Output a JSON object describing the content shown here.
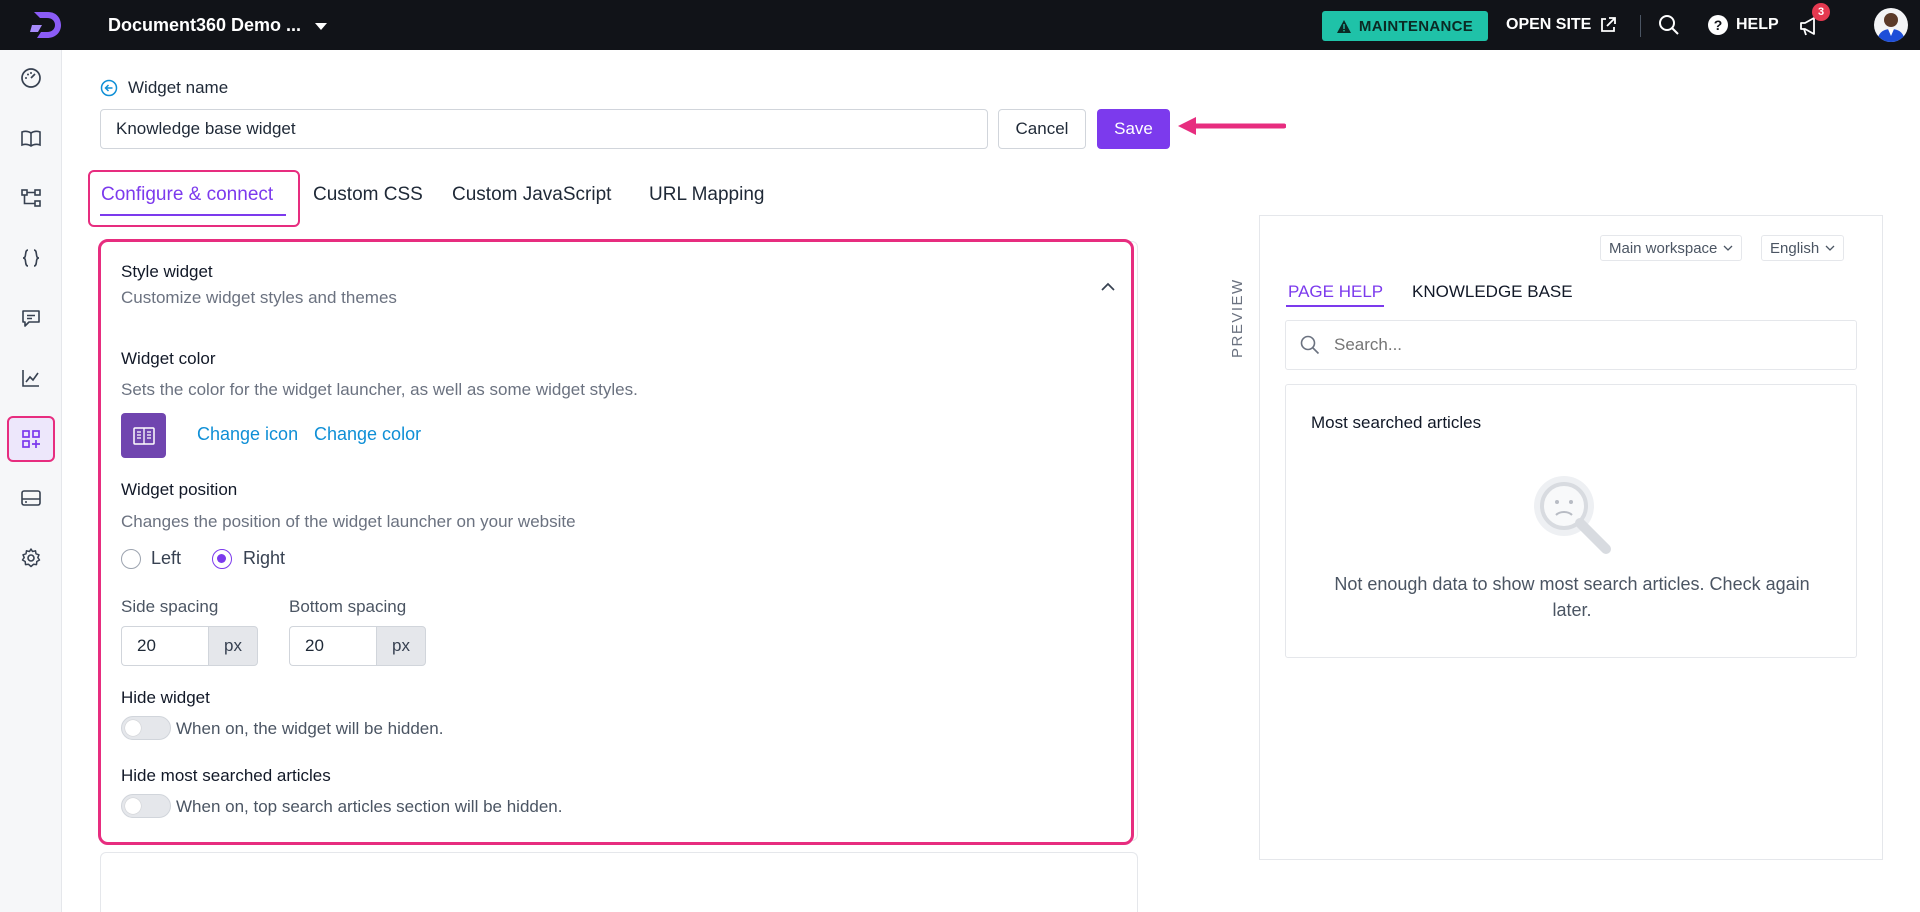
{
  "topbar": {
    "project_name": "Document360 Demo ...",
    "maintenance_label": "MAINTENANCE",
    "open_site_label": "OPEN SITE",
    "help_label": "HELP",
    "notification_count": "3"
  },
  "sidebar": {
    "items": [
      {
        "icon": "dashboard-icon"
      },
      {
        "icon": "documentation-icon"
      },
      {
        "icon": "category-tree-icon"
      },
      {
        "icon": "api-docs-icon"
      },
      {
        "icon": "feedback-icon"
      },
      {
        "icon": "analytics-icon"
      },
      {
        "icon": "widgets-icon",
        "active": true
      },
      {
        "icon": "drive-icon"
      },
      {
        "icon": "settings-icon"
      }
    ]
  },
  "header": {
    "back_label": "Widget name",
    "widget_name_value": "Knowledge base widget",
    "cancel_label": "Cancel",
    "save_label": "Save"
  },
  "tabs": [
    {
      "label": "Configure & connect",
      "active": true
    },
    {
      "label": "Custom CSS"
    },
    {
      "label": "Custom JavaScript"
    },
    {
      "label": "URL Mapping"
    }
  ],
  "style_widget": {
    "title": "Style widget",
    "subtitle": "Customize widget styles and themes",
    "widget_color": {
      "title": "Widget color",
      "description": "Sets the color for the widget launcher, as well as some widget styles.",
      "swatch_color": "#7045af",
      "change_icon_label": "Change icon",
      "change_color_label": "Change color"
    },
    "widget_position": {
      "title": "Widget position",
      "description": "Changes the position of the widget launcher on your website",
      "options": [
        "Left",
        "Right"
      ],
      "selected": "Right"
    },
    "side_spacing": {
      "label": "Side spacing",
      "value": "20",
      "unit": "px"
    },
    "bottom_spacing": {
      "label": "Bottom spacing",
      "value": "20",
      "unit": "px"
    },
    "hide_widget": {
      "title": "Hide widget",
      "description": "When on, the widget will be hidden.",
      "on": false
    },
    "hide_most_searched": {
      "title": "Hide most searched articles",
      "description": "When on, top search articles section will be hidden.",
      "on": false
    }
  },
  "preview": {
    "vertical_label": "PREVIEW",
    "workspace_dropdown": "Main workspace",
    "language_dropdown": "English",
    "tabs": [
      {
        "label": "PAGE HELP",
        "active": true
      },
      {
        "label": "KNOWLEDGE BASE"
      }
    ],
    "search_placeholder": "Search...",
    "most_searched_title": "Most searched articles",
    "empty_message": "Not enough data to show most search articles. Check again later."
  },
  "colors": {
    "accent": "#7c3aed",
    "highlight": "#e72d7f",
    "maintenance": "#1fc2a8",
    "link": "#0f8fd6"
  }
}
